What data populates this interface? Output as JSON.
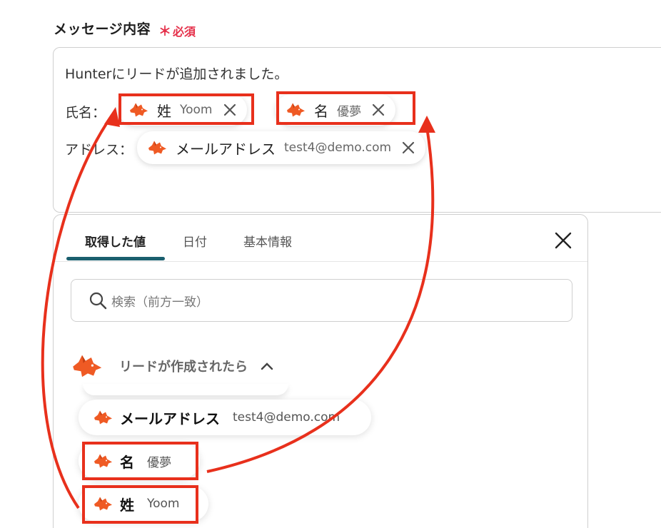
{
  "field": {
    "label": "メッセージ内容",
    "required_mark": "＊",
    "required_text": "必須"
  },
  "message": {
    "line1": "Hunterにリードが追加されました。",
    "line2_label": "氏名：",
    "line3_label": "アドレス："
  },
  "chips": {
    "last_name": {
      "label": "姓",
      "value": "Yoom"
    },
    "first_name": {
      "label": "名",
      "value": "優夢"
    },
    "email": {
      "label": "メールアドレス",
      "value": "test4@demo.com"
    }
  },
  "popup": {
    "tabs": [
      "取得した値",
      "日付",
      "基本情報"
    ],
    "active_tab": "取得した値",
    "search_placeholder": "検索（前方一致）",
    "section_title": "リードが作成されたら",
    "items": [
      {
        "label": "メールアドレス",
        "value": "test4@demo.com"
      },
      {
        "label": "名",
        "value": "優夢"
      },
      {
        "label": "姓",
        "value": "Yoom"
      }
    ]
  },
  "colors": {
    "accent": "#1a5f6e",
    "required": "#e5304a",
    "highlight": "#e8301c",
    "fox": "#ef5a24"
  },
  "icons": [
    "fox-icon",
    "close-icon",
    "search-icon",
    "chevron-up-icon",
    "remove-icon"
  ]
}
